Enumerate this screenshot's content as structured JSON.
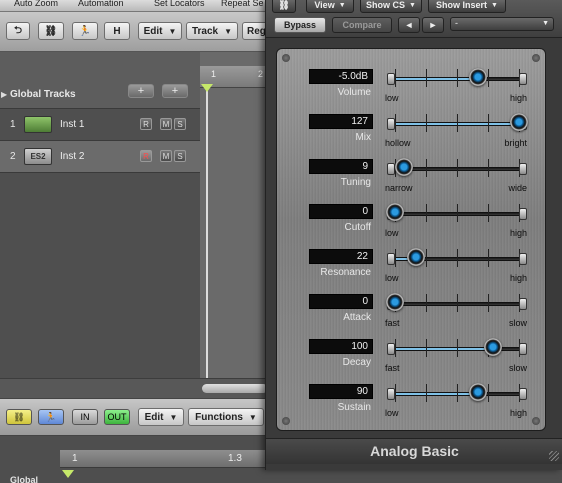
{
  "menubar": {
    "items": [
      "Auto Zoom",
      "Automation",
      "Set Locators",
      "Repeat Se"
    ]
  },
  "toolbar": {
    "edit_label": "Edit",
    "track_label": "Track",
    "region_label": "Regi",
    "h_label": "H"
  },
  "global_tracks": {
    "title": "Global Tracks",
    "add_button": "+",
    "add_special_button": "+"
  },
  "tracks": [
    {
      "number": "1",
      "name": "Inst 1",
      "icon_label": "",
      "r": "R",
      "m": "M",
      "s": "S",
      "selected": false
    },
    {
      "number": "2",
      "name": "Inst 2",
      "icon_label": "ES2",
      "r": "R",
      "m": "M",
      "s": "S",
      "selected": true
    }
  ],
  "ruler": {
    "marks": [
      "1",
      "2"
    ]
  },
  "bottom_toolbar": {
    "edit_label": "Edit",
    "functions_label": "Functions",
    "in_label": "IN",
    "out_label": "OUT"
  },
  "lower_pane": {
    "global_label": "Global",
    "ruler_marks": [
      "1",
      "1.3"
    ]
  },
  "plugin": {
    "view_label": "View",
    "show_cs_label": "Show CS",
    "show_insert_label": "Show Insert",
    "bypass_label": "Bypass",
    "compare_label": "Compare",
    "prev_label": "◄",
    "next_label": "►",
    "preset_value": "-",
    "title": "Analog Basic",
    "colors": {
      "knob": "#2b9ae0",
      "fill": "#7fc1e7",
      "display_bg": "#0c0c0c"
    },
    "params": [
      {
        "label": "Volume",
        "value": "-5.0dB",
        "min": "low",
        "max": "high",
        "level": 0.67
      },
      {
        "label": "Mix",
        "value": "127",
        "min": "hollow",
        "max": "bright",
        "level": 1.0
      },
      {
        "label": "Tuning",
        "value": "9",
        "min": "narrow",
        "max": "wide",
        "level": 0.07
      },
      {
        "label": "Cutoff",
        "value": "0",
        "min": "low",
        "max": "high",
        "level": 0.0
      },
      {
        "label": "Resonance",
        "value": "22",
        "min": "low",
        "max": "high",
        "level": 0.17
      },
      {
        "label": "Attack",
        "value": "0",
        "min": "fast",
        "max": "slow",
        "level": 0.0
      },
      {
        "label": "Decay",
        "value": "100",
        "min": "fast",
        "max": "slow",
        "level": 0.79
      },
      {
        "label": "Sustain",
        "value": "90",
        "min": "low",
        "max": "high",
        "level": 0.67
      }
    ]
  }
}
